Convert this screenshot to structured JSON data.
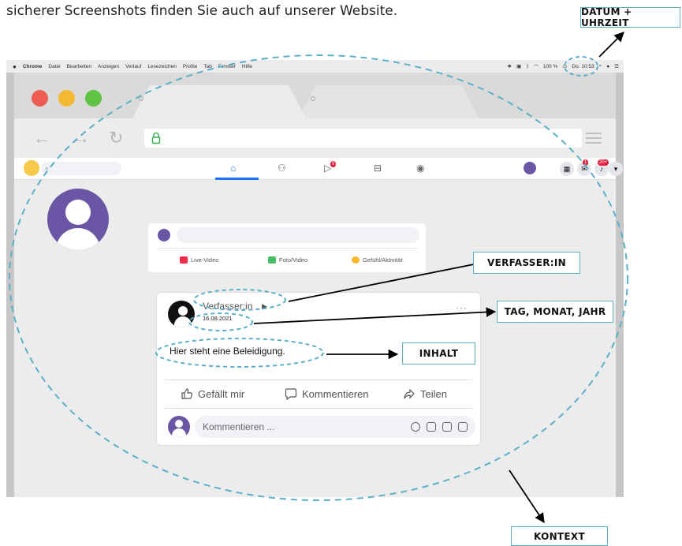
{
  "intro_text": "sicherer Screenshots finden Sie auch auf unserer Website.",
  "labels": {
    "datetime": "DATUM + UHRZEIT",
    "author": "VERFASSER:IN",
    "date": "TAG, MONAT, JAHR",
    "content": "INHALT",
    "context": "KONTEXT"
  },
  "menubar": {
    "items": [
      "Chrome",
      "Datei",
      "Bearbeiten",
      "Anzeigen",
      "Verlauf",
      "Lesezeichen",
      "Profile",
      "Tab",
      "Fenster",
      "Hilfe"
    ],
    "battery": "100 %",
    "clock": "Do. 10:53"
  },
  "facebook": {
    "search_icon": "search-icon",
    "badges": {
      "watch": "9",
      "messenger": "1",
      "notifications": "20+"
    }
  },
  "composer": {
    "actions": [
      "Live-Video",
      "Foto/Video",
      "Gefühl/Aktivität"
    ]
  },
  "post": {
    "author": "Verfasser:in",
    "date": "16.08.2021",
    "text": "Hier steht eine Beleidigung.",
    "more": "···",
    "actions": [
      "Gefällt mir",
      "Kommentieren",
      "Teilen"
    ],
    "comment_placeholder": "Kommentieren ..."
  },
  "colors": {
    "annotation": "#5bb0c9",
    "facebook_blue": "#1877f2",
    "avatar_purple": "#6b56a5",
    "traffic_red": "#ed5d52",
    "traffic_yellow": "#f4b933",
    "traffic_green": "#5ec244"
  }
}
